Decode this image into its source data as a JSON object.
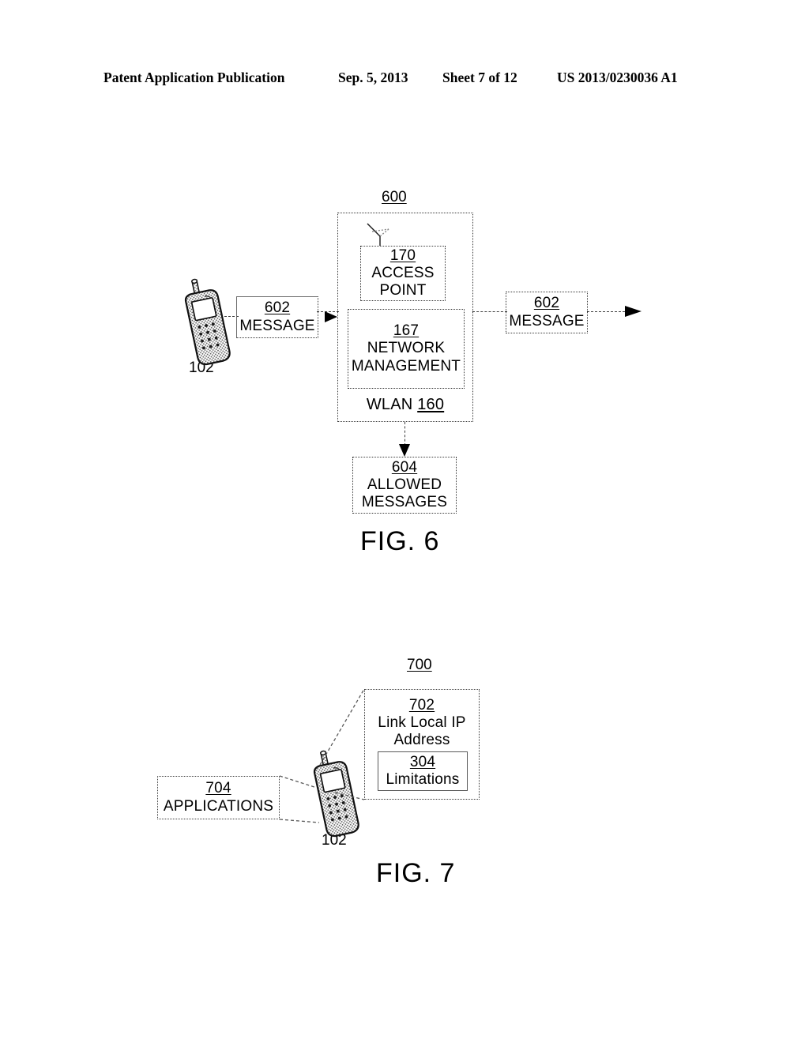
{
  "header": {
    "publication": "Patent Application Publication",
    "date": "Sep. 5, 2013",
    "sheet": "Sheet 7 of 12",
    "patent_number": "US 2013/0230036 A1"
  },
  "figures": [
    {
      "caption": "FIG. 6",
      "system_ref": "600",
      "nodes": {
        "mobile_device_ref": "102",
        "message_left": {
          "ref": "602",
          "label": "MESSAGE"
        },
        "message_right": {
          "ref": "602",
          "label": "MESSAGE"
        },
        "wlan": {
          "label": "WLAN",
          "ref": "160"
        },
        "access_point": {
          "ref": "170",
          "line1": "ACCESS",
          "line2": "POINT"
        },
        "network_management": {
          "ref": "167",
          "line1": "NETWORK",
          "line2": "MANAGEMENT"
        },
        "allowed_messages": {
          "ref": "604",
          "line1": "ALLOWED",
          "line2": "MESSAGES"
        }
      }
    },
    {
      "caption": "FIG. 7",
      "system_ref": "700",
      "nodes": {
        "mobile_device_ref": "102",
        "link_local_ip": {
          "ref": "702",
          "line1": "Link Local IP",
          "line2": "Address"
        },
        "limitations": {
          "ref": "304",
          "label": "Limitations"
        },
        "applications": {
          "ref": "704",
          "label": "APPLICATIONS"
        }
      }
    }
  ],
  "icons": {
    "mobile_phone": "mobile-phone-icon",
    "antenna": "antenna-icon",
    "arrow": "arrow-icon"
  },
  "colors": {
    "ink": "#000000",
    "line": "#3a3a3a",
    "background": "#ffffff"
  }
}
